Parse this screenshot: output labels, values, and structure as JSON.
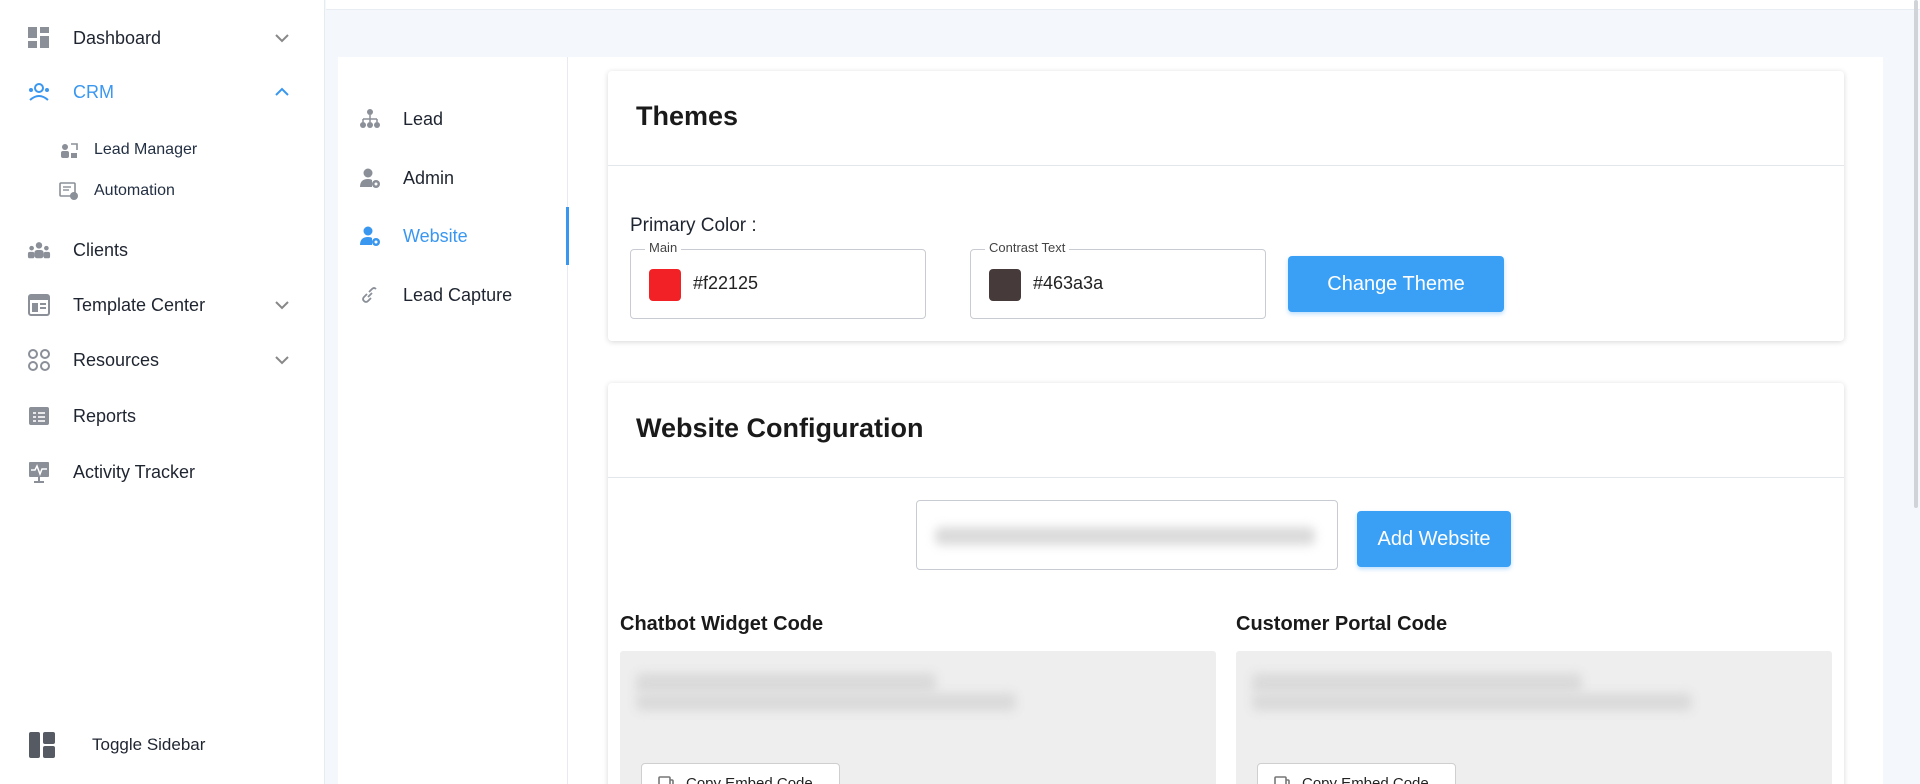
{
  "sidebar": {
    "items": [
      {
        "label": "Dashboard",
        "icon": "dashboard-icon"
      },
      {
        "label": "CRM",
        "icon": "crm-icon"
      },
      {
        "label": "Clients",
        "icon": "clients-icon"
      },
      {
        "label": "Template Center",
        "icon": "template-icon"
      },
      {
        "label": "Resources",
        "icon": "resources-icon"
      },
      {
        "label": "Reports",
        "icon": "reports-icon"
      },
      {
        "label": "Activity Tracker",
        "icon": "activity-icon"
      }
    ],
    "crm_sub_items": [
      {
        "label": "Lead Manager",
        "icon": "lead-manager-icon"
      },
      {
        "label": "Automation",
        "icon": "automation-icon"
      }
    ],
    "toggle_label": "Toggle Sidebar"
  },
  "settings_nav": {
    "items": [
      {
        "label": "Lead",
        "icon": "hierarchy-icon"
      },
      {
        "label": "Admin",
        "icon": "admin-gear-icon"
      },
      {
        "label": "Website",
        "icon": "website-user-icon"
      },
      {
        "label": "Lead Capture",
        "icon": "link-icon"
      }
    ],
    "active": "Website"
  },
  "themes": {
    "title": "Themes",
    "primary_color_label": "Primary Color :",
    "main": {
      "label": "Main",
      "value": "#f22125"
    },
    "contrast": {
      "label": "Contrast Text",
      "value": "#463a3a"
    },
    "change_button": "Change Theme"
  },
  "website_config": {
    "title": "Website Configuration",
    "add_button": "Add Website",
    "chatbot_title": "Chatbot Widget Code",
    "portal_title": "Customer Portal Code",
    "copy_label": "Copy Embed Code"
  },
  "colors": {
    "accent": "#3a97f0",
    "button": "#3aa0f5"
  }
}
